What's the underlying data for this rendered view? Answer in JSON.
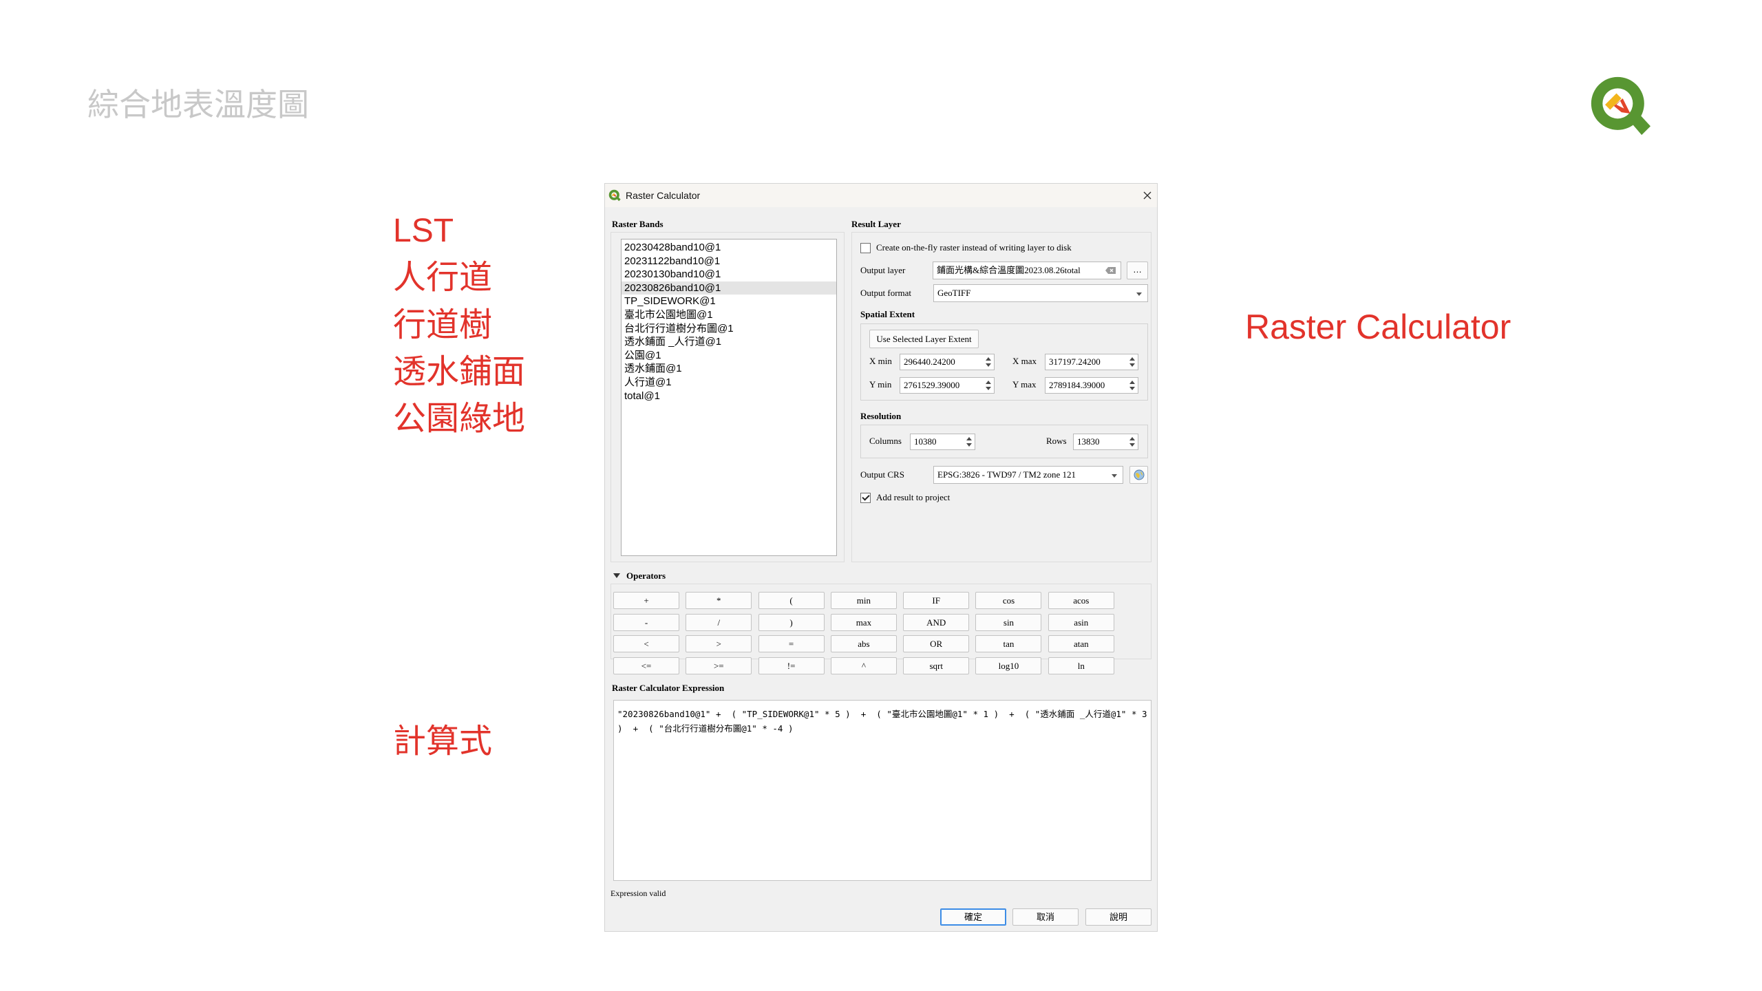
{
  "slide": {
    "title": "綜合地表溫度圖",
    "layer_labels": [
      "LST",
      "人行道",
      "行道樹",
      "透水鋪面",
      "公園綠地"
    ],
    "expression_caption": "計算式",
    "tool_caption": "Raster Calculator"
  },
  "icons": {
    "logo": "qgis-logo",
    "title_icon": "qgis-q-icon",
    "close": "close-icon",
    "clear": "clear-icon",
    "dropdown": "chevron-down-icon",
    "spinner": "spinner-icon",
    "crs": "globe-icon",
    "collapse": "collapse-triangle-icon"
  },
  "colors": {
    "annotation": "#e2332b",
    "title": "#c8c8c8",
    "selection": "#e4e4e4",
    "default_button_border": "#3c8ce6",
    "logo_green": "#589632",
    "logo_yellow": "#f2b51d",
    "logo_red": "#e2452a"
  },
  "dialog": {
    "title": "Raster Calculator",
    "raster_bands": {
      "label": "Raster Bands",
      "items": [
        "20230428band10@1",
        "20231122band10@1",
        "20230130band10@1",
        "20230826band10@1",
        "TP_SIDEWORK@1",
        "臺北市公園地圖@1",
        "台北行行道樹分布圖@1",
        "透水鋪面 _人行道@1",
        "公園@1",
        "透水鋪面@1",
        "人行道@1",
        "total@1"
      ],
      "selected_index": 3
    },
    "result_layer": {
      "label": "Result Layer",
      "on_the_fly": {
        "label": "Create on-the-fly raster instead of writing layer to disk",
        "checked": false
      },
      "output_layer": {
        "label": "Output layer",
        "value": "鋪面光構&綜合溫度圖2023.08.26total",
        "browse_label": "…"
      },
      "output_format": {
        "label": "Output format",
        "value": "GeoTIFF"
      },
      "spatial_extent": {
        "label": "Spatial Extent",
        "use_selected_label": "Use Selected Layer Extent",
        "x_min": {
          "label": "X min",
          "value": "296440.24200"
        },
        "x_max": {
          "label": "X max",
          "value": "317197.24200"
        },
        "y_min": {
          "label": "Y min",
          "value": "2761529.39000"
        },
        "y_max": {
          "label": "Y max",
          "value": "2789184.39000"
        }
      },
      "resolution": {
        "label": "Resolution",
        "columns": {
          "label": "Columns",
          "value": "10380"
        },
        "rows": {
          "label": "Rows",
          "value": "13830"
        }
      },
      "output_crs": {
        "label": "Output CRS",
        "value": "EPSG:3826 - TWD97 / TM2 zone 121"
      },
      "add_to_project": {
        "label": "Add result to project",
        "checked": true
      }
    },
    "operators": {
      "label": "Operators",
      "rows": [
        [
          "+",
          "*",
          "(",
          "min",
          "IF",
          "cos",
          "acos"
        ],
        [
          "-",
          "/",
          ")",
          "max",
          "AND",
          "sin",
          "asin"
        ],
        [
          "<",
          ">",
          "=",
          "abs",
          "OR",
          "tan",
          "atan"
        ],
        [
          "<=",
          ">=",
          "!=",
          "^",
          "sqrt",
          "log10",
          "ln"
        ]
      ]
    },
    "expression": {
      "label": "Raster Calculator Expression",
      "value": "\"20230826band10@1\" +  ( \"TP_SIDEWORK@1\" * 5 )  +  ( \"臺北市公園地圖@1\" * 1 )  +  ( \"透水鋪面 _人行道@1\" * 3 )  +  ( \"台北行行道樹分布圖@1\" * -4 )"
    },
    "status": "Expression valid",
    "buttons": {
      "ok": "確定",
      "cancel": "取消",
      "help": "說明"
    }
  }
}
